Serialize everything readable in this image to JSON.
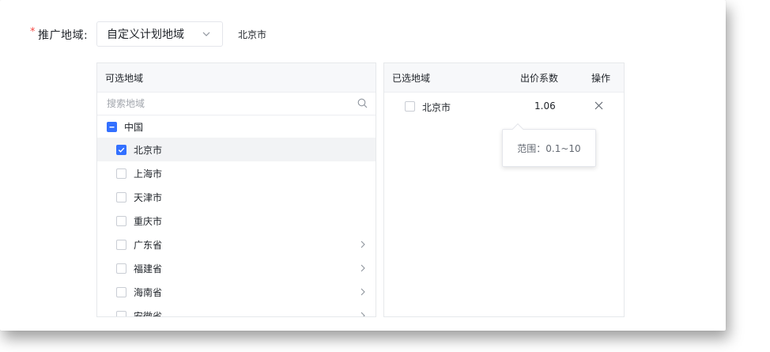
{
  "form": {
    "required_mark": "*",
    "label": "推广地域:",
    "select_value": "自定义计划地域",
    "selected_summary": "北京市"
  },
  "available": {
    "header": "可选地域",
    "search_placeholder": "搜索地域",
    "root": {
      "label": "中国",
      "state": "indeterminate"
    },
    "items": [
      {
        "label": "北京市",
        "checked": true,
        "expandable": false
      },
      {
        "label": "上海市",
        "checked": false,
        "expandable": false
      },
      {
        "label": "天津市",
        "checked": false,
        "expandable": false
      },
      {
        "label": "重庆市",
        "checked": false,
        "expandable": false
      },
      {
        "label": "广东省",
        "checked": false,
        "expandable": true
      },
      {
        "label": "福建省",
        "checked": false,
        "expandable": true
      },
      {
        "label": "海南省",
        "checked": false,
        "expandable": true
      },
      {
        "label": "安徽省",
        "checked": false,
        "expandable": true
      }
    ]
  },
  "selected": {
    "headers": {
      "name": "已选地域",
      "coef": "出价系数",
      "op": "操作"
    },
    "rows": [
      {
        "name": "北京市",
        "coef": "1.06"
      }
    ]
  },
  "tooltip": {
    "text": "范围：0.1~10"
  },
  "colors": {
    "primary": "#3370ff",
    "required": "#f54a45",
    "border": "#e6e8eb",
    "header_bg": "#f7f8fa"
  }
}
